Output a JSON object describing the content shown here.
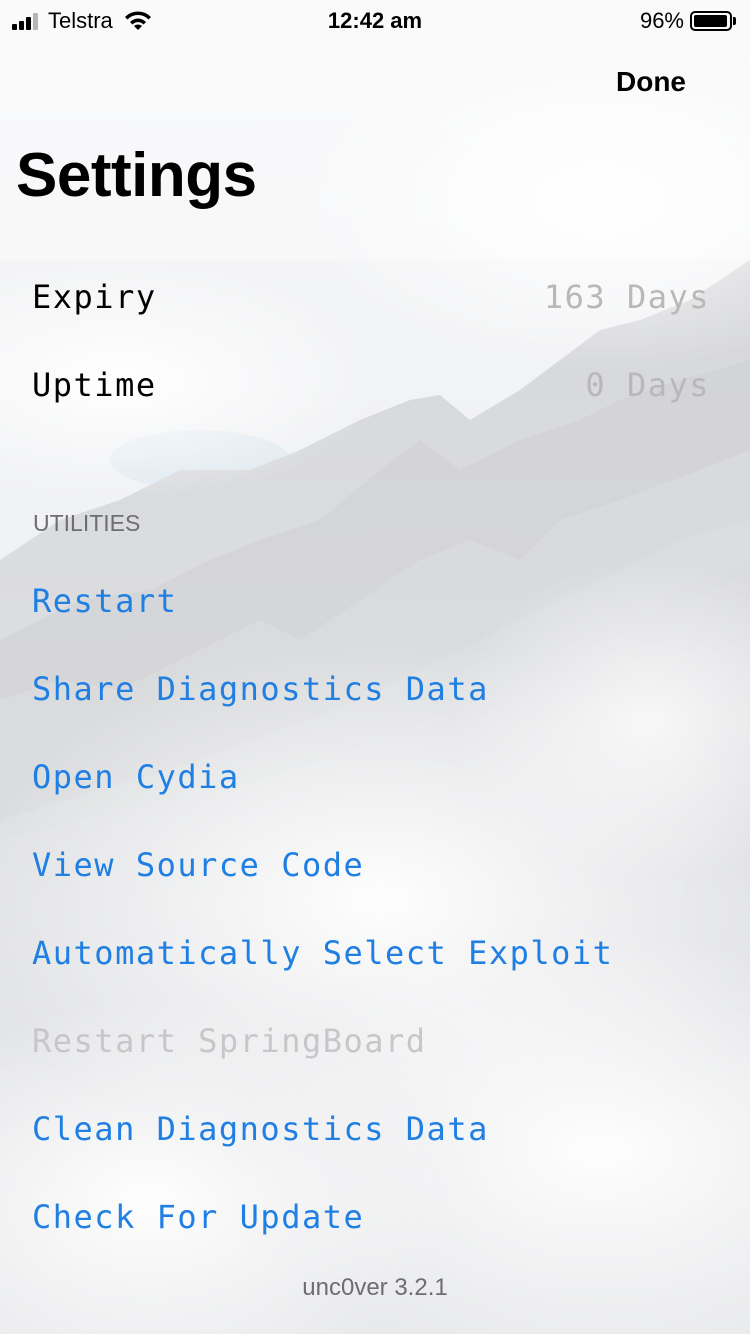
{
  "status_bar": {
    "carrier": "Telstra",
    "time": "12:42 am",
    "battery_percent": "96%",
    "battery_level": 0.96,
    "signal_bars_filled": 3,
    "signal_bars_total": 4
  },
  "nav": {
    "done_label": "Done"
  },
  "page": {
    "title": "Settings"
  },
  "info_rows": [
    {
      "label": "Expiry",
      "value": "163 Days"
    },
    {
      "label": "Uptime",
      "value": "0 Days"
    }
  ],
  "utilities": {
    "header": "UTILITIES",
    "items": [
      {
        "label": "Restart",
        "enabled": true
      },
      {
        "label": "Share Diagnostics Data",
        "enabled": true
      },
      {
        "label": "Open Cydia",
        "enabled": true
      },
      {
        "label": "View Source Code",
        "enabled": true
      },
      {
        "label": "Automatically Select Exploit",
        "enabled": true
      },
      {
        "label": "Restart SpringBoard",
        "enabled": false
      },
      {
        "label": "Clean Diagnostics Data",
        "enabled": true
      },
      {
        "label": "Check For Update",
        "enabled": true
      }
    ]
  },
  "footer": {
    "version": "unc0ver 3.2.1"
  },
  "colors": {
    "accent": "#1f7fe3",
    "disabled_text": "#c7c7c9",
    "secondary_text": "#b8b8b8",
    "section_header": "#6d6d72"
  }
}
